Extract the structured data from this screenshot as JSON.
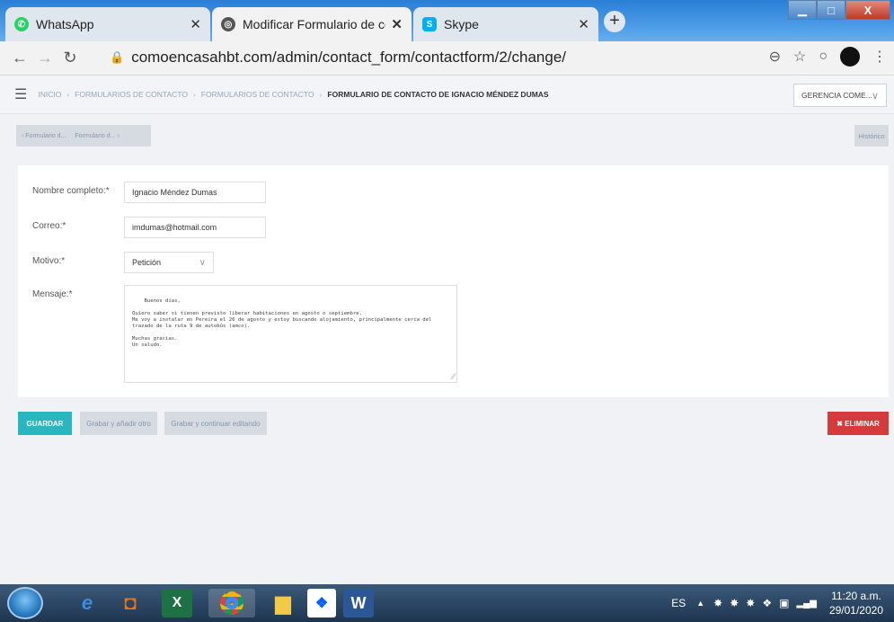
{
  "browser": {
    "tabs": [
      {
        "title": "WhatsApp",
        "icon": "whatsapp-icon",
        "color": "#25d366"
      },
      {
        "title": "Modificar Formulario de contacto",
        "icon": "globe-icon",
        "color": "#555555"
      },
      {
        "title": "Skype",
        "icon": "skype-icon",
        "color": "#00aff0"
      }
    ],
    "url": "comoencasahbt.com/admin/contact_form/contactform/2/change/"
  },
  "header": {
    "breadcrumb": [
      "INICIO",
      "FORMULARIOS DE CONTACTO",
      "FORMULARIOS DE CONTACTO"
    ],
    "current": "FORMULARIO DE CONTACTO DE IGNACIO MÉNDEZ DUMAS",
    "user_menu": "GERENCIA COME..."
  },
  "object_nav": {
    "prev": "‹ Formulario d...",
    "next": "Formulario d... ›",
    "history": "Histórico"
  },
  "form": {
    "name_label": "Nombre completo:*",
    "name_value": "Ignacio Méndez Dumas",
    "email_label": "Correo:*",
    "email_value": "imdumas@hotmail.com",
    "reason_label": "Motivo:*",
    "reason_value": "Petición",
    "message_label": "Mensaje:*",
    "message_value": "Buenos días,\n\nQuiero saber si tienen previsto liberar habitaciones en agosto o septiembre.\nMe voy a instalar en Pereira el 26 de agosto y estoy buscando alojamiento, principalmente cerca del\ntrazado de la ruta 9 de autobús (amco).\n\nMuchas gracias.\nUn saludo."
  },
  "actions": {
    "save": "GUARDAR",
    "save_add": "Grabar y añadir otro",
    "save_continue": "Grabar y continuar editando",
    "delete": "✖ ELIMINAR"
  },
  "taskbar": {
    "language": "ES",
    "time": "11:20 a.m.",
    "date": "29/01/2020"
  },
  "colors": {
    "accent": "#29b6c0",
    "danger": "#d63b3b"
  }
}
